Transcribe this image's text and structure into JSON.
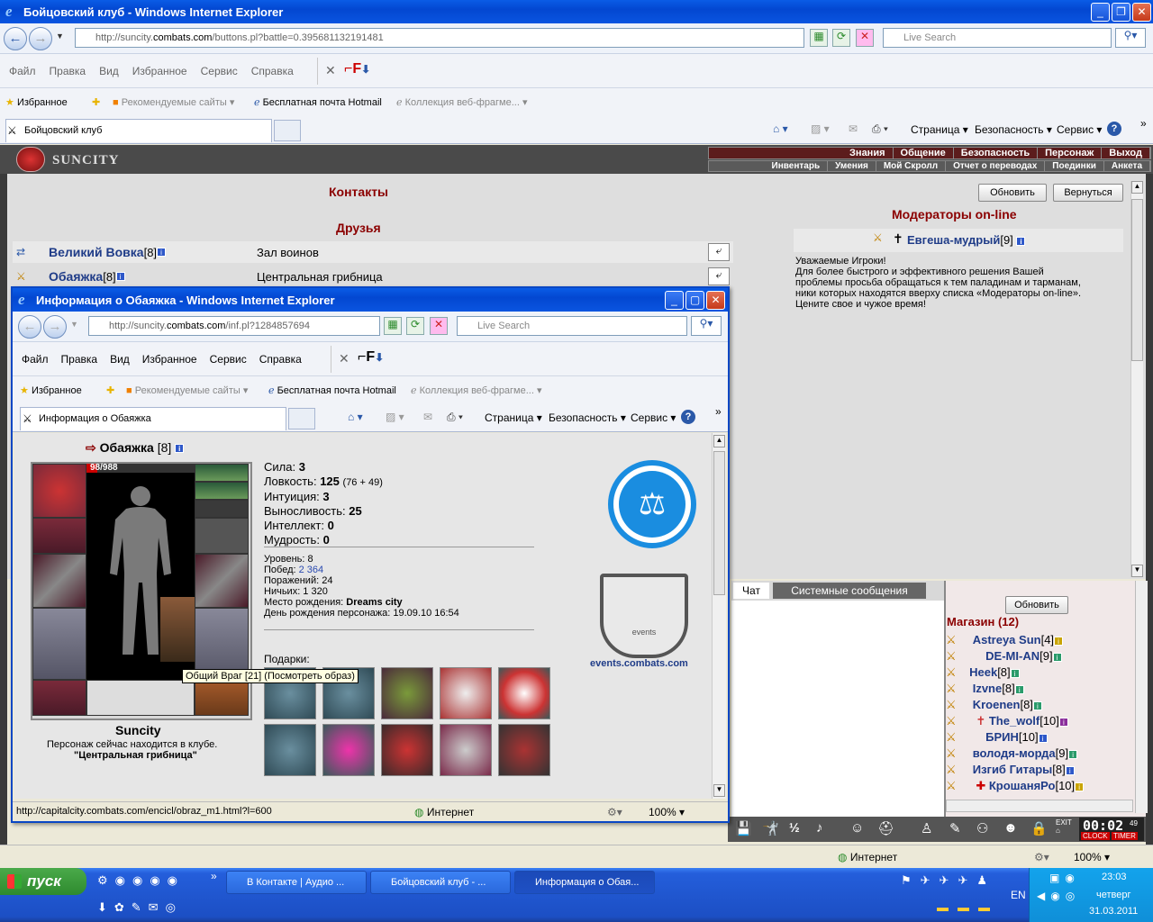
{
  "main_window": {
    "title": "Бойцовский клуб - Windows Internet Explorer",
    "url_prefix": "http://suncity.",
    "url_domain": "combats.com",
    "url_rest": "/buttons.pl?battle=0.395681132191481",
    "search_placeholder": "Live Search",
    "menu": [
      "Файл",
      "Правка",
      "Вид",
      "Избранное",
      "Сервис",
      "Справка"
    ],
    "favorites_label": "Избранное",
    "fav_links": [
      "Рекомендуемые сайты ▾",
      "Бесплатная почта Hotmail",
      "Коллекция веб-фрагме... ▾"
    ],
    "tab_label": "Бойцовский клуб",
    "commandbar": [
      "Страница ▾",
      "Безопасность ▾",
      "Сервис ▾"
    ],
    "status_zone": "Интернет",
    "zoom": "100%"
  },
  "game": {
    "logo": "SUNCITY",
    "nav_top": [
      "Знания",
      "Общение",
      "Безопасность",
      "Персонаж",
      "Выход"
    ],
    "nav_bottom": [
      "Инвентарь",
      "Умения",
      "Мой Скролл",
      "Отчет о переводах",
      "Поединки",
      "Анкета"
    ],
    "contacts_title": "Контакты",
    "friends_title": "Друзья",
    "friends": [
      {
        "name": "Великий Вовка",
        "level": "[8]",
        "location": "Зал воинов"
      },
      {
        "name": "Обаяжка",
        "level": "[8]",
        "location": "Центральная грибница"
      }
    ],
    "refresh_button": "Обновить",
    "back_button": "Вернуться",
    "moderators_title": "Модераторы on-line",
    "moderator": {
      "name": "Евгеша-мудрый",
      "level": "[9]"
    },
    "moderator_notice": [
      "Уважаемые Игроки!",
      "Для более быстрого и эффективного решения Вашей",
      "проблемы просьба обращаться к тем паладинам и тарманам,",
      "ники которых находятся вверху списка «Модераторы on-line».",
      "Цените свое и чужое время!"
    ],
    "chat_tabs": [
      "Чат",
      "Системные сообщения"
    ],
    "room_refresh": "Обновить",
    "room_title": "Магазин (12)",
    "room_users": [
      {
        "name": "Astreya Sun",
        "level": "[4]"
      },
      {
        "name": "DE-MI-AN",
        "level": "[9]"
      },
      {
        "name": "Heek",
        "level": "[8]"
      },
      {
        "name": "Izvne",
        "level": "[8]"
      },
      {
        "name": "Kroenen",
        "level": "[8]"
      },
      {
        "name": "The_wolf",
        "level": "[10]"
      },
      {
        "name": "БРИН",
        "level": "[10]"
      },
      {
        "name": "володя-морда",
        "level": "[9]"
      },
      {
        "name": "Изгиб Гитары",
        "level": "[8]"
      },
      {
        "name": "КрошаняРо",
        "level": "[10]"
      }
    ],
    "clock": "00:02",
    "clock_seconds": "49",
    "clock_label1": "CLOCK",
    "clock_label2": "TIMER"
  },
  "popup": {
    "title": "Информация о Обаяжка - Windows Internet Explorer",
    "url_prefix": "http://suncity.",
    "url_domain": "combats.com",
    "url_rest": "/inf.pl?1284857694",
    "search_placeholder": "Live Search",
    "menu": [
      "Файл",
      "Правка",
      "Вид",
      "Избранное",
      "Сервис",
      "Справка"
    ],
    "favorites_label": "Избранное",
    "fav_links": [
      "Рекомендуемые сайты ▾",
      "Бесплатная почта Hotmail",
      "Коллекция веб-фрагме... ▾"
    ],
    "tab_label": "Информация о Обаяжка",
    "commandbar": [
      "Страница ▾",
      "Безопасность ▾",
      "Сервис ▾"
    ],
    "char_name": "Обаяжка",
    "char_level": "[8]",
    "hp": "98/988",
    "stats": [
      {
        "label": "Сила:",
        "value": "3",
        "extra": ""
      },
      {
        "label": "Ловкость:",
        "value": "125",
        "extra": "(76 + 49)"
      },
      {
        "label": "Интуиция:",
        "value": "3",
        "extra": ""
      },
      {
        "label": "Выносливость:",
        "value": "25",
        "extra": ""
      },
      {
        "label": "Интеллект:",
        "value": "0",
        "extra": ""
      },
      {
        "label": "Мудрость:",
        "value": "0",
        "extra": ""
      }
    ],
    "level_line": "Уровень: 8",
    "wins_label": "Побед:",
    "wins_value": "2 364",
    "losses_line": "Поражений: 24",
    "draws_line": "Ничьих: 1 320",
    "birthplace_label": "Место рождения:",
    "birthplace_value": "Dreams city",
    "birthday_line": "День рождения персонажа: 19.09.10 16:54",
    "gifts_label": "Подарки:",
    "city": "Suncity",
    "location_line": "Персонаж сейчас находится в клубе.",
    "location_room": "\"Центральная грибница\"",
    "tooltip": "Общий Враг [21] (Посмотреть образ)",
    "events_link": "events.combats.com",
    "events_shield_text": "events",
    "status_url": "http://capitalcity.combats.com/encicl/obraz_m1.html?l=600",
    "status_zone": "Интернет",
    "zoom": "100%"
  },
  "taskbar": {
    "start": "пуск",
    "tasks": [
      "В Контакте | Аудио ...",
      "Бойцовский клуб - ...",
      "Информация о Обая..."
    ],
    "lang": "EN",
    "time": "23:03",
    "day": "четверг",
    "date": "31.03.2011"
  }
}
